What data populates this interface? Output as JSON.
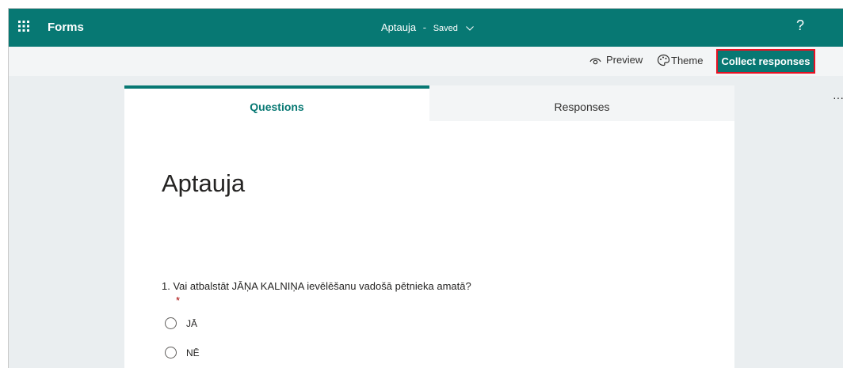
{
  "topbar": {
    "app_name": "Forms",
    "doc_title": "Aptauja",
    "separator": "-",
    "status": "Saved",
    "help": "?"
  },
  "toolbar": {
    "preview_label": "Preview",
    "theme_label": "Theme",
    "collect_label": "Collect responses",
    "more_label": "···"
  },
  "tabs": [
    {
      "label": "Questions",
      "active": true
    },
    {
      "label": "Responses",
      "active": false
    }
  ],
  "form": {
    "title": "Aptauja",
    "questions": [
      {
        "text": "1. Vai atbalstāt JĀŅA KALNIŅA ievēlēšanu vadošā pētnieka amatā?",
        "required_mark": "*",
        "options": [
          "JĀ",
          "NĒ"
        ]
      }
    ]
  },
  "colors": {
    "brand": "#077873",
    "highlight_border": "#e81123",
    "background": "#eaeef0"
  },
  "icons": {
    "waffle": "app-launcher-icon",
    "preview": "eye-icon",
    "theme": "palette-icon",
    "chevron": "chevron-down-icon"
  }
}
